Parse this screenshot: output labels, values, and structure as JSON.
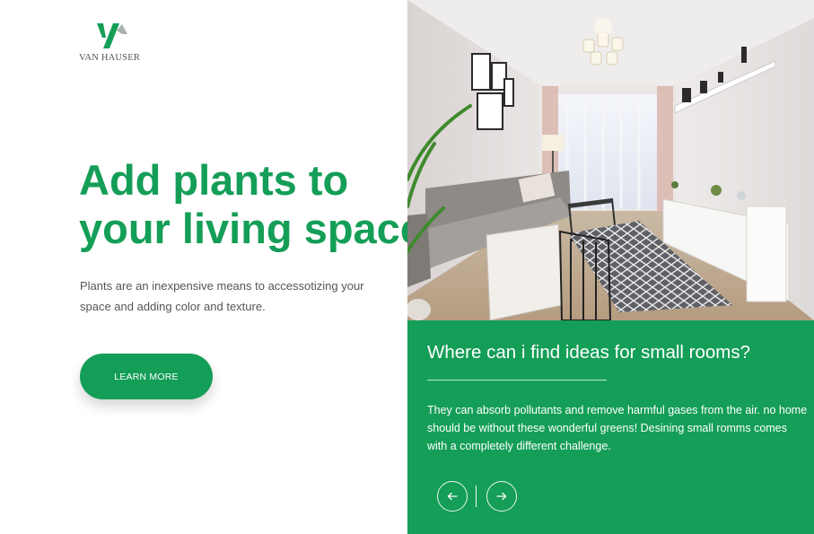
{
  "brand": {
    "name": "VAN HAUSER",
    "logo_icon": "vh-monogram-icon",
    "accent_color": "#149e57"
  },
  "hero": {
    "headline_line1": "Add plants to",
    "headline_line2": "your living space",
    "subtitle": "Plants are an inexpensive means to accessotizing your space and adding color and texture.",
    "cta_label": "LEARN MORE"
  },
  "photo": {
    "alt": "Living room interior photo",
    "icon": "living-room-photo"
  },
  "card": {
    "title": "Where can i find ideas for small rooms?",
    "body": "They can absorb pollutants and remove harmful gases from the air. no home should be without these wonderful greens! Desining small romms comes with a completely different challenge.",
    "prev_icon": "arrow-left-icon",
    "next_icon": "arrow-right-icon",
    "background_color": "#149e57"
  }
}
